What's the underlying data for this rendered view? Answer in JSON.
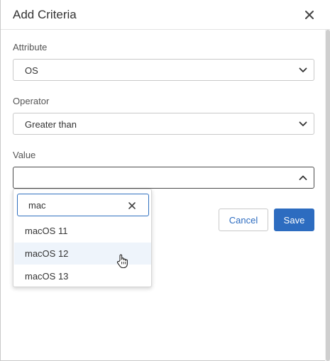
{
  "dialog": {
    "title": "Add Criteria",
    "close_icon": "close-icon"
  },
  "attribute": {
    "label": "Attribute",
    "value": "OS"
  },
  "operator": {
    "label": "Operator",
    "value": "Greater than"
  },
  "value_field": {
    "label": "Value",
    "value": ""
  },
  "dropdown": {
    "search_value": "mac",
    "options": [
      "macOS 11",
      "macOS 12",
      "macOS 13"
    ],
    "hovered": "macOS 12"
  },
  "buttons": {
    "cancel": "Cancel",
    "save": "Save"
  },
  "colors": {
    "accent": "#2d6cc0",
    "hover": "#eef4fb"
  }
}
